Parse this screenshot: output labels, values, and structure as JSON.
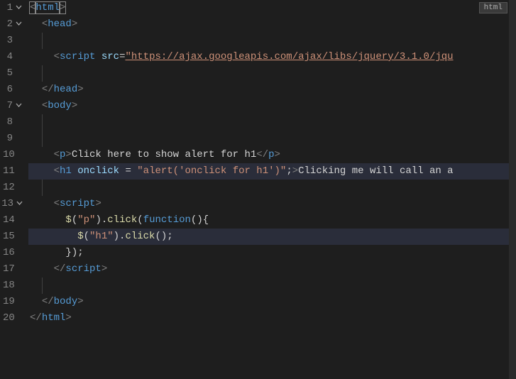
{
  "lang_badge": "html",
  "gutter": {
    "lines": [
      "1",
      "2",
      "3",
      "4",
      "5",
      "6",
      "7",
      "8",
      "9",
      "10",
      "11",
      "12",
      "13",
      "14",
      "15",
      "16",
      "17",
      "18",
      "19",
      "20"
    ],
    "folds": {
      "1": true,
      "2": true,
      "7": true,
      "13": true
    }
  },
  "code": {
    "line1": {
      "open_b": "<",
      "tag": "html",
      "close_b": ">"
    },
    "line2": {
      "open_b": "<",
      "tag": "head",
      "close_b": ">"
    },
    "line4": {
      "open_b": "<",
      "tag": "script",
      "attr": "src",
      "eq": "=",
      "str": "\"https://ajax.googleapis.com/ajax/libs/jquery/3.1.0/jqu"
    },
    "line6": {
      "open_b": "</",
      "tag": "head",
      "close_b": ">"
    },
    "line7": {
      "open_b": "<",
      "tag": "body",
      "close_b": ">"
    },
    "line10": {
      "open_b": "<",
      "tag": "p",
      "close_b": ">",
      "text": "Click here to show alert for h1",
      "open_b2": "</",
      "tag2": "p",
      "close_b2": ">"
    },
    "line11": {
      "open_b": "<",
      "tag": "h1",
      "attr": "onclick",
      "eq": " = ",
      "str": "\"alert('onclick for h1')\"",
      "semi": ";",
      "close_b": ">",
      "text": "Clicking me will call an a"
    },
    "line13": {
      "open_b": "<",
      "tag": "script",
      "close_b": ">"
    },
    "line14": {
      "dollar": "$",
      "paren_o": "(",
      "str": "\"p\"",
      "paren_c": ")",
      ".": ".",
      "fn": "click",
      "paren_o2": "(",
      "kw": "function",
      "paren_o3": "(",
      "paren_c3": ")",
      "brace": "{"
    },
    "line15": {
      "dollar": "$",
      "paren_o": "(",
      "str": "\"h1\"",
      "paren_c": ")",
      ".": ".",
      "fn": "click",
      "paren_o2": "(",
      "paren_c2": ")",
      "semi": ";"
    },
    "line16": {
      "brace": "}",
      "paren_c": ")",
      "semi": ";"
    },
    "line17": {
      "open_b": "</",
      "tag": "script",
      "close_b": ">"
    },
    "line19": {
      "open_b": "</",
      "tag": "body",
      "close_b": ">"
    },
    "line20": {
      "open_b": "</",
      "tag": "html",
      "close_b": ">"
    }
  }
}
